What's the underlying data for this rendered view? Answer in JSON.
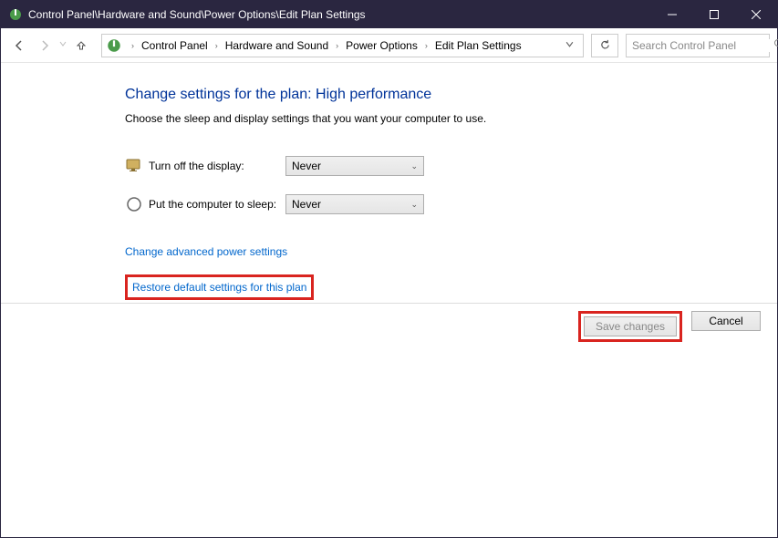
{
  "titlebar": {
    "path": "Control Panel\\Hardware and Sound\\Power Options\\Edit Plan Settings"
  },
  "breadcrumbs": {
    "items": [
      "Control Panel",
      "Hardware and Sound",
      "Power Options",
      "Edit Plan Settings"
    ]
  },
  "search": {
    "placeholder": "Search Control Panel"
  },
  "main": {
    "heading": "Change settings for the plan: High performance",
    "subtext": "Choose the sleep and display settings that you want your computer to use.",
    "settings": {
      "display_off": {
        "label": "Turn off the display:",
        "value": "Never"
      },
      "sleep": {
        "label": "Put the computer to sleep:",
        "value": "Never"
      }
    },
    "links": {
      "advanced": "Change advanced power settings",
      "restore": "Restore default settings for this plan"
    }
  },
  "footer": {
    "save": "Save changes",
    "cancel": "Cancel"
  }
}
